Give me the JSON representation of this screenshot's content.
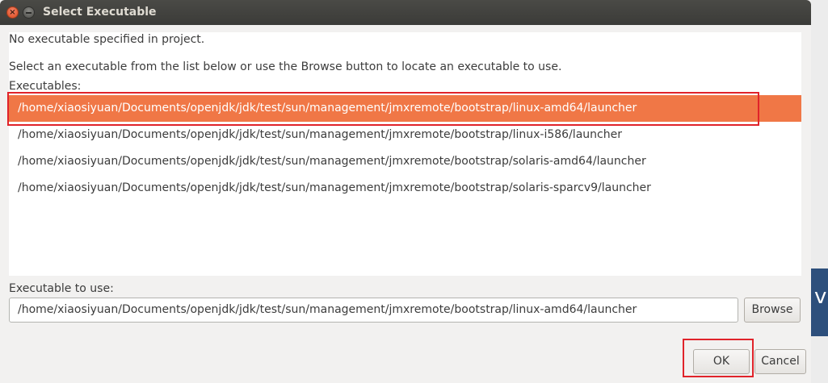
{
  "window": {
    "title": "Select Executable"
  },
  "messages": {
    "line1": "No executable specified in project.",
    "line2": "Select an executable from the list below or use the Browse button to locate an executable to use."
  },
  "executables": {
    "label": "Executables:",
    "items": [
      {
        "path": "/home/xiaosiyuan/Documents/openjdk/jdk/test/sun/management/jmxremote/bootstrap/linux-amd64/launcher",
        "selected": true
      },
      {
        "path": "/home/xiaosiyuan/Documents/openjdk/jdk/test/sun/management/jmxremote/bootstrap/linux-i586/launcher",
        "selected": false
      },
      {
        "path": "/home/xiaosiyuan/Documents/openjdk/jdk/test/sun/management/jmxremote/bootstrap/solaris-amd64/launcher",
        "selected": false
      },
      {
        "path": "/home/xiaosiyuan/Documents/openjdk/jdk/test/sun/management/jmxremote/bootstrap/solaris-sparcv9/launcher",
        "selected": false
      }
    ]
  },
  "executable_to_use": {
    "label": "Executable to use:",
    "value": "/home/xiaosiyuan/Documents/openjdk/jdk/test/sun/management/jmxremote/bootstrap/linux-amd64/launcher"
  },
  "buttons": {
    "browse": "Browse",
    "ok": "OK",
    "cancel": "Cancel"
  },
  "background": {
    "text": "va"
  },
  "colors": {
    "selection": "#f07746",
    "highlight_box": "#e0232a",
    "titlebar": "#3b3b38"
  }
}
